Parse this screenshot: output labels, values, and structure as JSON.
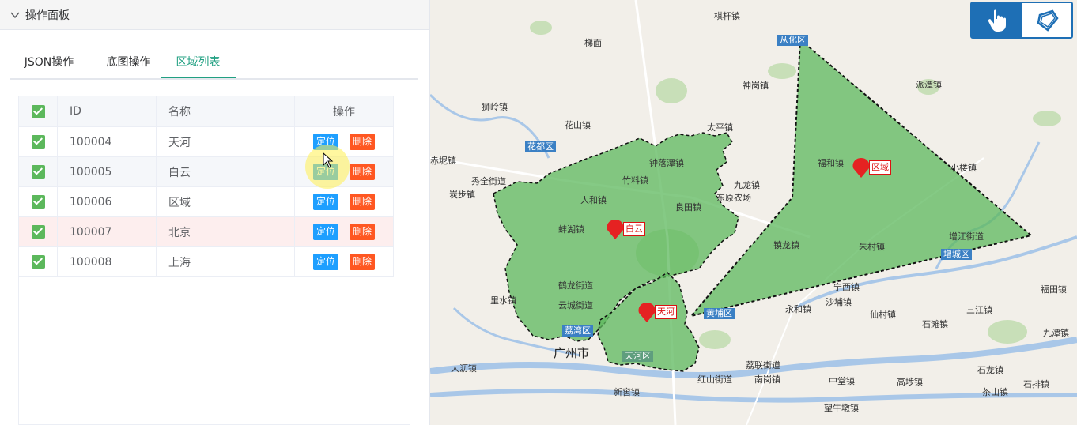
{
  "panel": {
    "title": "操作面板"
  },
  "tabs": [
    {
      "label": "JSON操作"
    },
    {
      "label": "底图操作"
    },
    {
      "label": "区域列表"
    }
  ],
  "table": {
    "headers": {
      "id": "ID",
      "name": "名称",
      "op": "操作"
    },
    "locate_label": "定位",
    "delete_label": "删除",
    "rows": [
      {
        "id": "100004",
        "name": "天河"
      },
      {
        "id": "100005",
        "name": "白云"
      },
      {
        "id": "100006",
        "name": "区域"
      },
      {
        "id": "100007",
        "name": "北京"
      },
      {
        "id": "100008",
        "name": "上海"
      }
    ]
  },
  "map": {
    "labels": [
      {
        "text": "棋杆镇"
      },
      {
        "text": "梯面"
      },
      {
        "text": "从化区"
      },
      {
        "text": "神岗镇"
      },
      {
        "text": "派潭镇"
      },
      {
        "text": "狮岭镇"
      },
      {
        "text": "花山镇"
      },
      {
        "text": "太平镇"
      },
      {
        "text": "花都区"
      },
      {
        "text": "赤坭镇"
      },
      {
        "text": "秀全街道"
      },
      {
        "text": "钟落潭镇"
      },
      {
        "text": "竹料镇"
      },
      {
        "text": "九龙镇"
      },
      {
        "text": "东原农场"
      },
      {
        "text": "福和镇"
      },
      {
        "text": "小楼镇"
      },
      {
        "text": "炭步镇"
      },
      {
        "text": "人和镇"
      },
      {
        "text": "良田镇"
      },
      {
        "text": "蚌湖镇"
      },
      {
        "text": "镇龙镇"
      },
      {
        "text": "朱村镇"
      },
      {
        "text": "增江街道"
      },
      {
        "text": "增城区"
      },
      {
        "text": "宁西镇"
      },
      {
        "text": "鹤龙街道"
      },
      {
        "text": "里水镇"
      },
      {
        "text": "沙埔镇"
      },
      {
        "text": "云城街道"
      },
      {
        "text": "永和镇"
      },
      {
        "text": "仙村镇"
      },
      {
        "text": "三江镇"
      },
      {
        "text": "福田镇"
      },
      {
        "text": "黄埔区"
      },
      {
        "text": "石滩镇"
      },
      {
        "text": "九潭镇"
      },
      {
        "text": "荔湾区"
      },
      {
        "text": "广州市"
      },
      {
        "text": "天河区"
      },
      {
        "text": "荔联街道"
      },
      {
        "text": "大沥镇"
      },
      {
        "text": "红山街道"
      },
      {
        "text": "南岗镇"
      },
      {
        "text": "中堂镇"
      },
      {
        "text": "高埗镇"
      },
      {
        "text": "石龙镇"
      },
      {
        "text": "石排镇"
      },
      {
        "text": "茶山镇"
      },
      {
        "text": "新窖镇"
      },
      {
        "text": "望牛墩镇"
      }
    ],
    "markers": [
      {
        "label": "区域"
      },
      {
        "label": "白云"
      },
      {
        "label": "天河"
      }
    ]
  },
  "toolbar": {
    "pointer_tool": "hand-pointer-icon",
    "polygon_tool": "polygon-draw-icon"
  },
  "colors": {
    "accent": "#21a082",
    "locate": "#1e9fff",
    "delete": "#ff5722",
    "region": "#5cb85c"
  }
}
